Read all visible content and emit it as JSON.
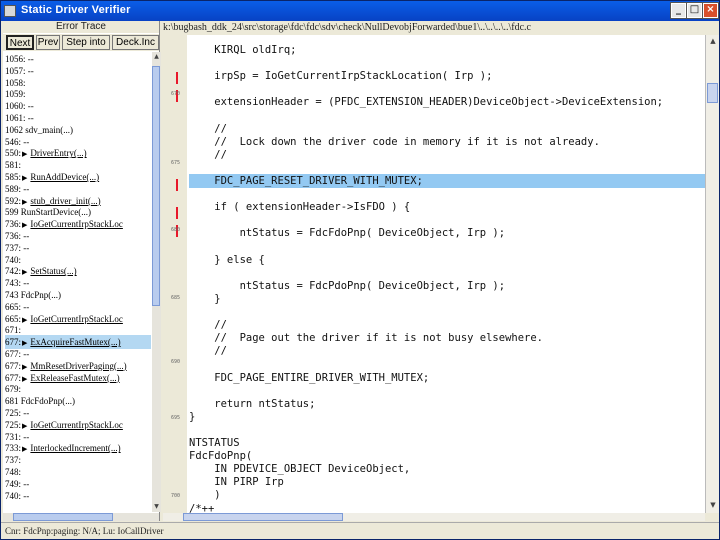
{
  "window": {
    "title": "Static Driver Verifier"
  },
  "left_pane": {
    "title": "Error Trace",
    "buttons": [
      {
        "label": "Next",
        "active": true
      },
      {
        "label": "Prev",
        "active": false
      },
      {
        "label": "Step into",
        "active": false
      },
      {
        "label": "Deck.Inc",
        "active": false
      }
    ],
    "trace": [
      {
        "text": "1056: --",
        "arrow": false,
        "hl": false
      },
      {
        "text": "1057: --",
        "arrow": false,
        "hl": false
      },
      {
        "text": "1058:",
        "arrow": false,
        "hl": false
      },
      {
        "text": "1059:",
        "arrow": false,
        "hl": false
      },
      {
        "text": "1060: --",
        "arrow": false,
        "hl": false
      },
      {
        "text": "1061: --",
        "arrow": false,
        "hl": false
      },
      {
        "text": "1062 sdv_main(...)",
        "arrow": false,
        "hl": false
      },
      {
        "text": "546: --",
        "arrow": false,
        "hl": false
      },
      {
        "text": "550:",
        "arrow": true,
        "label": "DriverEntry(...)",
        "hl": false
      },
      {
        "text": "581:",
        "arrow": false,
        "hl": false
      },
      {
        "text": "585:",
        "arrow": true,
        "label": "RunAddDevice(...)",
        "hl": false
      },
      {
        "text": "589: --",
        "arrow": false,
        "hl": false
      },
      {
        "text": "592:",
        "arrow": true,
        "label": "stub_driver_init(...)",
        "hl": false
      },
      {
        "text": "599 RunStartDevice(...)",
        "arrow": false,
        "hl": false
      },
      {
        "text": "736:",
        "arrow": true,
        "label": "IoGetCurrentIrpStackLoc",
        "hl": false
      },
      {
        "text": "736: --",
        "arrow": false,
        "hl": false
      },
      {
        "text": "737: --",
        "arrow": false,
        "hl": false
      },
      {
        "text": "740:",
        "arrow": false,
        "hl": false
      },
      {
        "text": "742:",
        "arrow": true,
        "label": "SetStatus(...)",
        "hl": false
      },
      {
        "text": "743: --",
        "arrow": false,
        "hl": false
      },
      {
        "text": "743 FdcPnp(...)",
        "arrow": false,
        "hl": false
      },
      {
        "text": "665: --",
        "arrow": false,
        "hl": false
      },
      {
        "text": "665:",
        "arrow": true,
        "label": "IoGetCurrentIrpStackLoc",
        "hl": false
      },
      {
        "text": "671:",
        "arrow": false,
        "hl": false
      },
      {
        "text": "677:",
        "arrow": true,
        "label": "ExAcquireFastMutex(...)",
        "hl": true
      },
      {
        "text": "677: --",
        "arrow": false,
        "hl": false
      },
      {
        "text": "677:",
        "arrow": true,
        "label": "MmResetDriverPaging(...)",
        "hl": false
      },
      {
        "text": "677:",
        "arrow": true,
        "label": "ExReleaseFastMutex(...)",
        "hl": false
      },
      {
        "text": "679:",
        "arrow": false,
        "hl": false
      },
      {
        "text": "681 FdcFdoPnp(...)",
        "arrow": false,
        "hl": false
      },
      {
        "text": "725: --",
        "arrow": false,
        "hl": false
      },
      {
        "text": "725:",
        "arrow": true,
        "label": "IoGetCurrentIrpStackLoc",
        "hl": false
      },
      {
        "text": "731: --",
        "arrow": false,
        "hl": false
      },
      {
        "text": "733:",
        "arrow": true,
        "label": "InterlockedIncrement(...)",
        "hl": false
      },
      {
        "text": "737:",
        "arrow": false,
        "hl": false
      },
      {
        "text": "748:",
        "arrow": false,
        "hl": false
      },
      {
        "text": "749: --",
        "arrow": false,
        "hl": false
      },
      {
        "text": "740: --",
        "arrow": false,
        "hl": false
      }
    ]
  },
  "code_pane": {
    "path": "k:\\bugbash_ddk_24\\src\\storage\\fdc\\fdc\\sdv\\check\\NullDevobjForwarded\\bue1\\..\\..\\..\\..\\fdc.c",
    "lines": [
      {
        "text": "    KIRQL oldIrq;",
        "hl": false
      },
      {
        "text": "",
        "hl": false
      },
      {
        "text": "    irpSp = IoGetCurrentIrpStackLocation( Irp );",
        "hl": false
      },
      {
        "text": "",
        "hl": false
      },
      {
        "text": "    extensionHeader = (PFDC_EXTENSION_HEADER)DeviceObject->DeviceExtension;",
        "hl": false
      },
      {
        "text": "",
        "hl": false
      },
      {
        "text": "    //",
        "hl": false
      },
      {
        "text": "    //  Lock down the driver code in memory if it is not already.",
        "hl": false
      },
      {
        "text": "    //",
        "hl": false
      },
      {
        "text": "",
        "hl": false
      },
      {
        "text": "    FDC_PAGE_RESET_DRIVER_WITH_MUTEX;",
        "hl": true
      },
      {
        "text": "",
        "hl": false
      },
      {
        "text": "    if ( extensionHeader->IsFDO ) {",
        "hl": false
      },
      {
        "text": "",
        "hl": false
      },
      {
        "text": "        ntStatus = FdcFdoPnp( DeviceObject, Irp );",
        "hl": false
      },
      {
        "text": "",
        "hl": false
      },
      {
        "text": "    } else {",
        "hl": false
      },
      {
        "text": "",
        "hl": false
      },
      {
        "text": "        ntStatus = FdcPdoPnp( DeviceObject, Irp );",
        "hl": false
      },
      {
        "text": "    }",
        "hl": false
      },
      {
        "text": "",
        "hl": false
      },
      {
        "text": "    //",
        "hl": false
      },
      {
        "text": "    //  Page out the driver if it is not busy elsewhere.",
        "hl": false
      },
      {
        "text": "    //",
        "hl": false
      },
      {
        "text": "",
        "hl": false
      },
      {
        "text": "    FDC_PAGE_ENTIRE_DRIVER_WITH_MUTEX;",
        "hl": false
      },
      {
        "text": "",
        "hl": false
      },
      {
        "text": "    return ntStatus;",
        "hl": false
      },
      {
        "text": "}",
        "hl": false
      },
      {
        "text": "",
        "hl": false
      },
      {
        "text": "NTSTATUS",
        "hl": false
      },
      {
        "text": "FdcFdoPnp(",
        "hl": false
      },
      {
        "text": "    IN PDEVICE_OBJECT DeviceObject,",
        "hl": false
      },
      {
        "text": "    IN PIRP Irp",
        "hl": false
      },
      {
        "text": "    )",
        "hl": false
      },
      {
        "text": "/*++",
        "hl": false
      }
    ]
  },
  "status": {
    "text": "Cnr: FdcPnp:paging: N/A; Lu: IoCallDriver"
  }
}
